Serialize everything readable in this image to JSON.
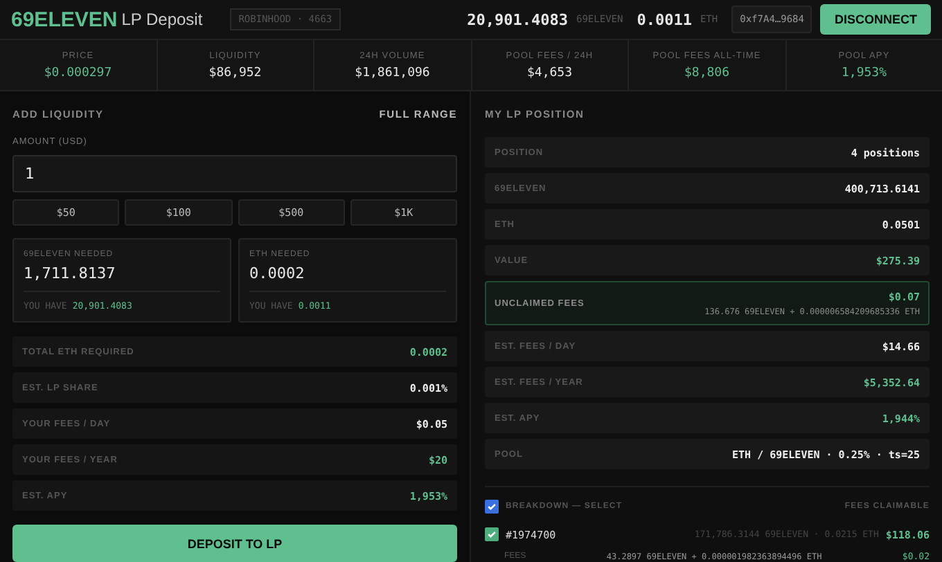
{
  "header": {
    "brand": "69ELEVEN",
    "subtitle": "LP Deposit",
    "account_badge": "ROBINHOOD · 4663",
    "balances": [
      {
        "amount": "20,901.4083",
        "unit": "69ELEVEN"
      },
      {
        "amount": "0.0011",
        "unit": "ETH"
      }
    ],
    "address": "0xf7A4…9684",
    "disconnect_button": "DISCONNECT"
  },
  "stats": [
    {
      "label": "PRICE",
      "value": "$0.000297",
      "accent": true
    },
    {
      "label": "LIQUIDITY",
      "value": "$86,952",
      "accent": false
    },
    {
      "label": "24H VOLUME",
      "value": "$1,861,096",
      "accent": false
    },
    {
      "label": "POOL FEES / 24H",
      "value": "$4,653",
      "accent": false
    },
    {
      "label": "POOL FEES ALL-TIME",
      "value": "$8,806",
      "accent": true
    },
    {
      "label": "POOL APY",
      "value": "1,953%",
      "accent": true
    }
  ],
  "add_liquidity": {
    "title": "ADD LIQUIDITY",
    "range": "FULL RANGE",
    "amount_label": "AMOUNT (USD)",
    "amount_value": "1",
    "presets": [
      "$50",
      "$100",
      "$500",
      "$1K"
    ],
    "needed": [
      {
        "label": "69ELEVEN NEEDED",
        "value": "1,711.8137",
        "have_label": "YOU HAVE",
        "have_value": "20,901.4083"
      },
      {
        "label": "ETH NEEDED",
        "value": "0.0002",
        "have_label": "YOU HAVE",
        "have_value": "0.0011"
      }
    ],
    "rows": [
      {
        "label": "TOTAL ETH REQUIRED",
        "value": "0.0002",
        "accent": true
      },
      {
        "label": "EST. LP SHARE",
        "value": "0.001%",
        "accent": false
      },
      {
        "label": "YOUR FEES / DAY",
        "value": "$0.05",
        "accent": false
      },
      {
        "label": "YOUR FEES / YEAR",
        "value": "$20",
        "accent": true
      },
      {
        "label": "EST. APY",
        "value": "1,953%",
        "accent": true
      }
    ],
    "deposit_button": "DEPOSIT TO LP"
  },
  "my_position": {
    "title": "MY LP POSITION",
    "rows": [
      {
        "kind": "plain",
        "label": "POSITION",
        "value": "4 positions",
        "accent": false
      },
      {
        "kind": "plain",
        "label": "69ELEVEN",
        "value": "400,713.6141",
        "accent": false
      },
      {
        "kind": "plain",
        "label": "ETH",
        "value": "0.0501",
        "accent": false
      },
      {
        "kind": "plain",
        "label": "VALUE",
        "value": "$275.39",
        "accent": true
      },
      {
        "kind": "highlight",
        "label": "UNCLAIMED FEES",
        "value": "$0.07",
        "detail": "136.676 69ELEVEN + 0.000006584209685336 ETH",
        "accent": true
      },
      {
        "kind": "plain",
        "label": "EST. FEES / DAY",
        "value": "$14.66",
        "accent": false
      },
      {
        "kind": "plain",
        "label": "EST. FEES / YEAR",
        "value": "$5,352.64",
        "accent": true
      },
      {
        "kind": "plain",
        "label": "EST. APY",
        "value": "1,944%",
        "accent": true
      },
      {
        "kind": "plain",
        "label": "POOL",
        "value": "ETH / 69ELEVEN · 0.25% · ts=25",
        "accent": false
      }
    ],
    "breakdown": {
      "label": "BREAKDOWN — SELECT",
      "checked": true,
      "fees_header": "FEES CLAIMABLE",
      "positions": [
        {
          "id": "#1974700",
          "checked": true,
          "amounts": "171,786.3144 69ELEVEN · 0.0215 ETH",
          "value": "$118.06",
          "fees_label": "FEES",
          "fees_amounts": "43.2897 69ELEVEN + 0.000001982363894496 ETH",
          "fees_value": "$0.02"
        }
      ]
    }
  }
}
